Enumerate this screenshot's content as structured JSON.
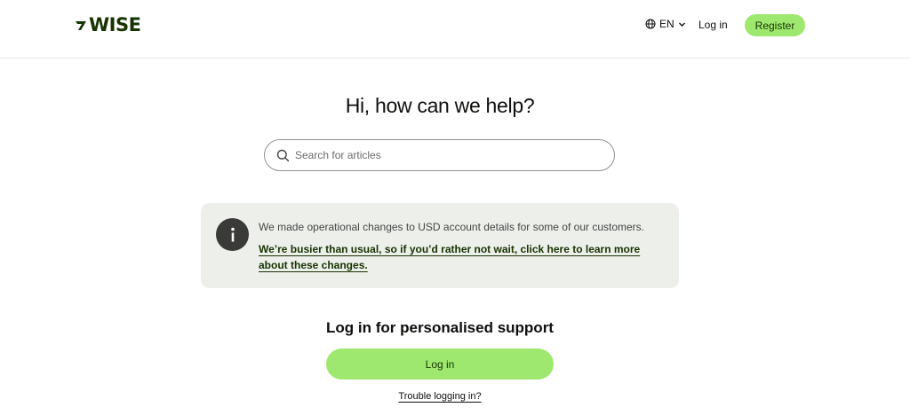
{
  "header": {
    "logo_text": "WISE",
    "language_label": "EN",
    "login_label": "Log in",
    "register_label": "Register",
    "icons": {
      "logo": "wise-flag-icon",
      "language": "globe-icon",
      "language_caret": "chevron-down-icon"
    }
  },
  "main": {
    "title": "Hi, how can we help?",
    "search": {
      "placeholder": "Search for articles",
      "value": "",
      "icon": "search-icon"
    },
    "notice": {
      "icon": "info-icon",
      "text": "We made operational changes to USD account details for some of our customers.",
      "link": "We’re busier than usual, so if you’d rather not wait, click here to learn more about these changes."
    },
    "support": {
      "title": "Log in for personalised support",
      "login_button": "Log in",
      "trouble_link": "Trouble logging in?"
    }
  },
  "colors": {
    "brand_green": "#9fe870",
    "brand_dark": "#163300",
    "notice_bg": "#edefeb"
  }
}
